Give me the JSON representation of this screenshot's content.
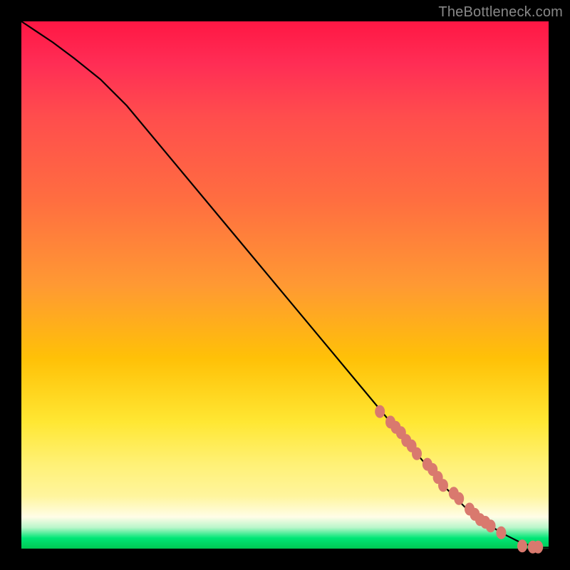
{
  "watermark": "TheBottleneck.com",
  "chart_data": {
    "type": "line",
    "title": "",
    "xlabel": "",
    "ylabel": "",
    "xlim": [
      0,
      100
    ],
    "ylim": [
      0,
      100
    ],
    "grid": false,
    "legend": false,
    "series": [
      {
        "name": "curve",
        "style": "line",
        "color": "#000000",
        "x": [
          0,
          3,
          6,
          10,
          15,
          20,
          30,
          40,
          50,
          60,
          70,
          75,
          80,
          85,
          88,
          91,
          93,
          95,
          97,
          98,
          99,
          100
        ],
        "y": [
          100,
          98,
          96,
          93,
          89,
          84,
          72,
          60,
          48,
          36,
          24,
          18,
          12,
          7,
          5,
          3,
          2,
          1,
          0.5,
          0.3,
          0.2,
          0.2
        ]
      },
      {
        "name": "markers",
        "style": "points",
        "color": "#d9796e",
        "x": [
          68,
          70,
          71,
          72,
          73,
          74,
          75,
          77,
          78,
          79,
          80,
          82,
          83,
          85,
          86,
          87,
          88,
          89,
          91,
          95,
          97,
          98
        ],
        "y": [
          26,
          24,
          23,
          22,
          20.5,
          19.5,
          18,
          16,
          15,
          13.5,
          12,
          10.5,
          9.5,
          7.5,
          6.5,
          5.5,
          5,
          4.3,
          3,
          0.5,
          0.3,
          0.3
        ]
      }
    ],
    "background_gradient": {
      "orientation": "vertical",
      "stops": [
        {
          "pos": 0.0,
          "color": "#ff1744"
        },
        {
          "pos": 0.5,
          "color": "#ff9933"
        },
        {
          "pos": 0.76,
          "color": "#ffe733"
        },
        {
          "pos": 0.94,
          "color": "#fffde7"
        },
        {
          "pos": 0.98,
          "color": "#00e676"
        },
        {
          "pos": 1.0,
          "color": "#00c853"
        }
      ]
    }
  }
}
